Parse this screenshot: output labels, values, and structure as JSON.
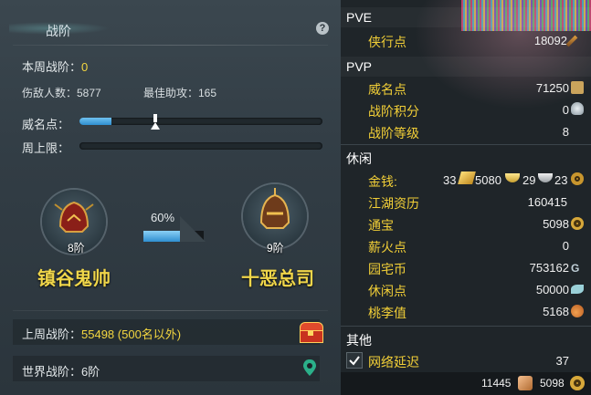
{
  "left": {
    "title": "战阶",
    "help_glyph": "?",
    "weekly_rank_label": "本周战阶：",
    "weekly_rank_value": "0",
    "kills_label": "伤敌人数：5877",
    "best_assist_label": "最佳助攻：165",
    "prestige_label": "威名点：",
    "prestige_fill": 0.13,
    "weekly_cap_label": "周上限：",
    "weekly_cap_fill": 0,
    "current_rank": {
      "level": "8阶",
      "name": "镇谷鬼帅"
    },
    "progress_text": "60%",
    "progress_value": 0.6,
    "next_rank": {
      "level": "9阶",
      "name": "十恶总司"
    },
    "last_week_label": "上周战阶：",
    "last_week_value": "55498 (500名以外)",
    "world_rank_label": "世界战阶：6阶"
  },
  "right": {
    "pve": {
      "title": "PVE",
      "rows": [
        {
          "label": "侠行点",
          "value": "18092"
        }
      ]
    },
    "pvp": {
      "title": "PVP",
      "rows": [
        {
          "label": "威名点",
          "value": "71250"
        },
        {
          "label": "战阶积分",
          "value": "0"
        },
        {
          "label": "战阶等级",
          "value": "8"
        }
      ]
    },
    "leisure": {
      "title": "休闲",
      "rows": [
        {
          "label": "金钱:",
          "gold": "33",
          "silver": "5080",
          "copper1": "29",
          "copper2": "23"
        },
        {
          "label": "江湖资历",
          "value": "160415"
        },
        {
          "label": "通宝",
          "value": "5098"
        },
        {
          "label": "薪火点",
          "value": "0"
        },
        {
          "label": "园宅币",
          "value": "753162"
        },
        {
          "label": "休闲点",
          "value": "50000"
        },
        {
          "label": "桃李值",
          "value": "5168"
        }
      ]
    },
    "other": {
      "title": "其他",
      "rows": [
        {
          "label": "网络延迟",
          "value": "37",
          "checked": true
        }
      ]
    },
    "bottom": {
      "left_value": "11445",
      "right_value": "5098"
    }
  },
  "colors": {
    "accent_yellow": "#f3d640",
    "bar_blue": "#2f8fd0",
    "label_gold": "#f2cf37"
  }
}
